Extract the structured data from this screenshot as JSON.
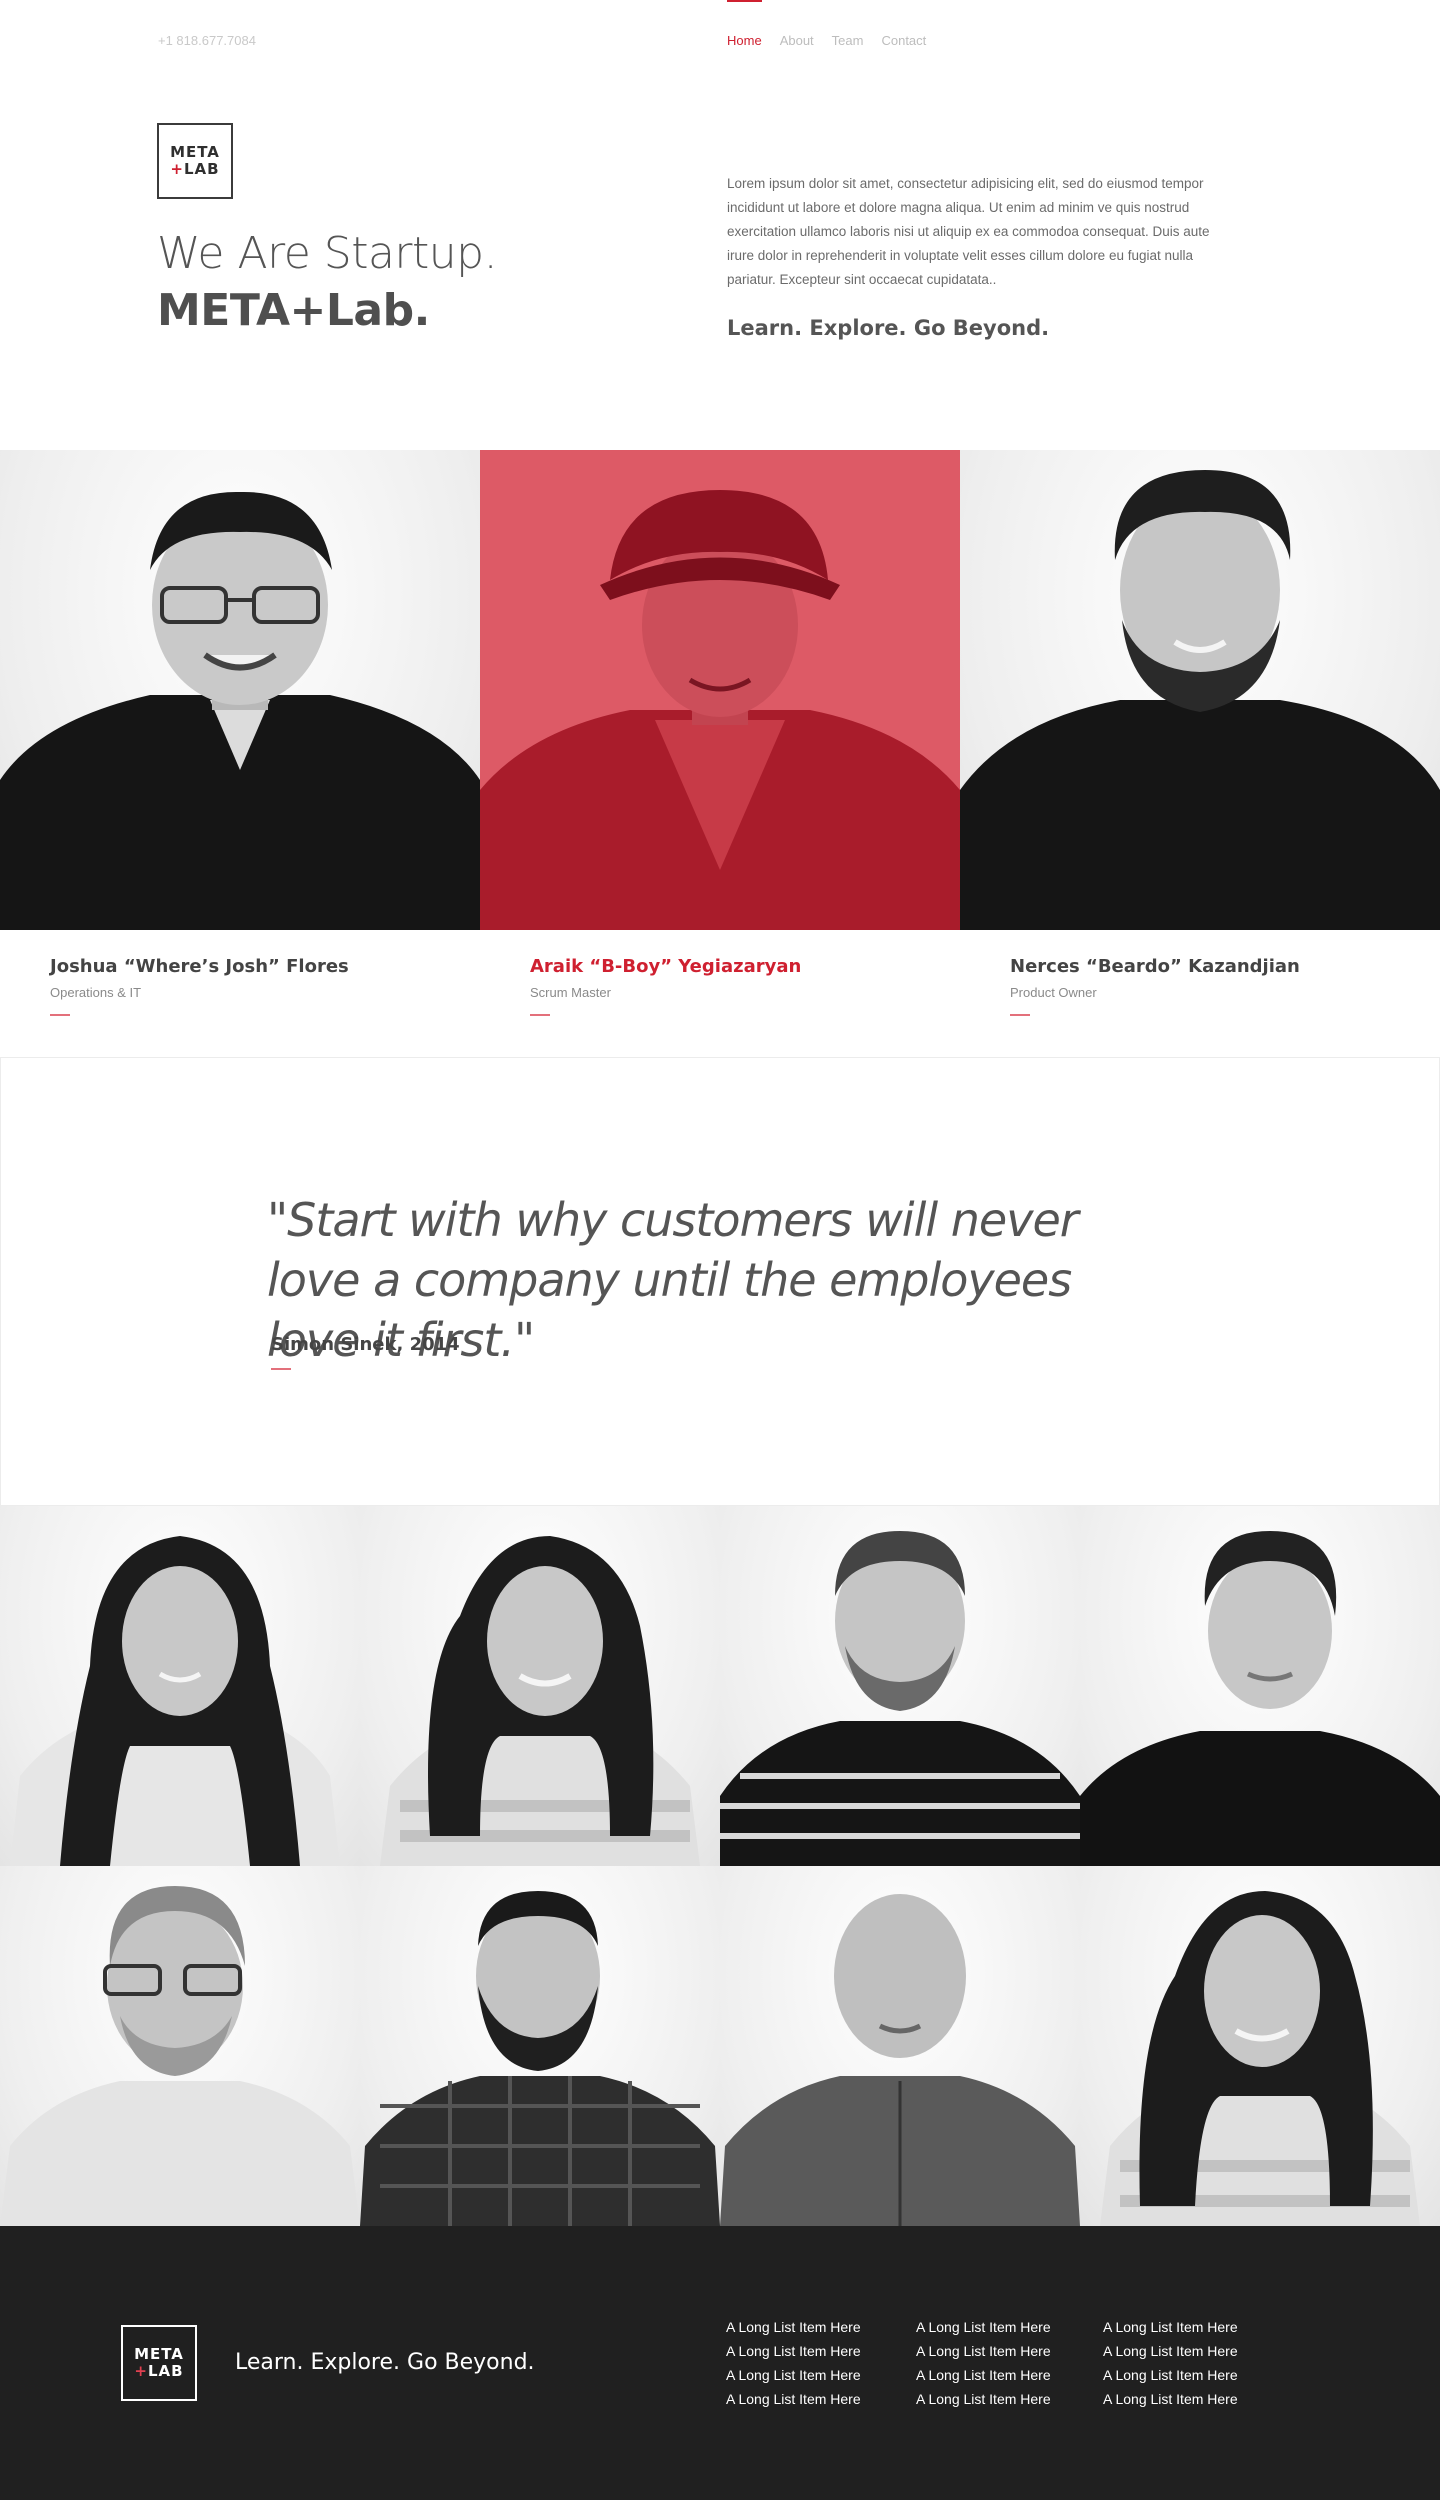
{
  "header": {
    "phone": "+1 818.677.7084",
    "nav": [
      {
        "label": "Home",
        "active": true
      },
      {
        "label": "About",
        "active": false
      },
      {
        "label": "Team",
        "active": false
      },
      {
        "label": "Contact",
        "active": false
      }
    ]
  },
  "brand": {
    "logo_line1": "META",
    "logo_plus": "+",
    "logo_line2": "LAB",
    "accent_color": "#cf2030"
  },
  "hero": {
    "title_light": "We Are Startup.",
    "title_bold": "META+Lab.",
    "paragraph": "Lorem ipsum dolor sit amet, consectetur adipisicing elit, sed do eiusmod tempor incididunt ut labore et dolore magna aliqua. Ut enim ad minim ve quis nostrud exercitation ullamco laboris nisi ut aliquip ex ea commodoa consequat. Duis aute irure dolor in reprehenderit in voluptate velit esses cillum dolore eu fugiat nulla pariatur. Excepteur sint occaecat cupidatata..",
    "tagline": "Learn. Explore. Go Beyond."
  },
  "featured_team": [
    {
      "name": "Joshua “Where’s Josh” Flores",
      "role": "Operations & IT",
      "highlighted": false
    },
    {
      "name": "Araik “B-Boy” Yegiazaryan",
      "role": "Scrum Master",
      "highlighted": true
    },
    {
      "name": "Nerces “Beardo” Kazandjian",
      "role": "Product Owner",
      "highlighted": false
    }
  ],
  "quote": {
    "text": "\"Start with why customers will never love a company until the employees love it first.\"",
    "author": "Simon Sinek, 2014"
  },
  "footer": {
    "tagline": "Learn. Explore. Go Beyond.",
    "columns": [
      [
        "A Long List Item Here",
        "A Long List Item Here",
        "A Long List Item Here",
        "A Long List Item Here"
      ],
      [
        "A Long List Item Here",
        "A Long List Item Here",
        "A Long List Item Here",
        "A Long List Item Here"
      ],
      [
        "A Long List Item Here",
        "A Long List Item Here",
        "A Long List Item Here",
        "A Long List Item Here"
      ]
    ]
  }
}
